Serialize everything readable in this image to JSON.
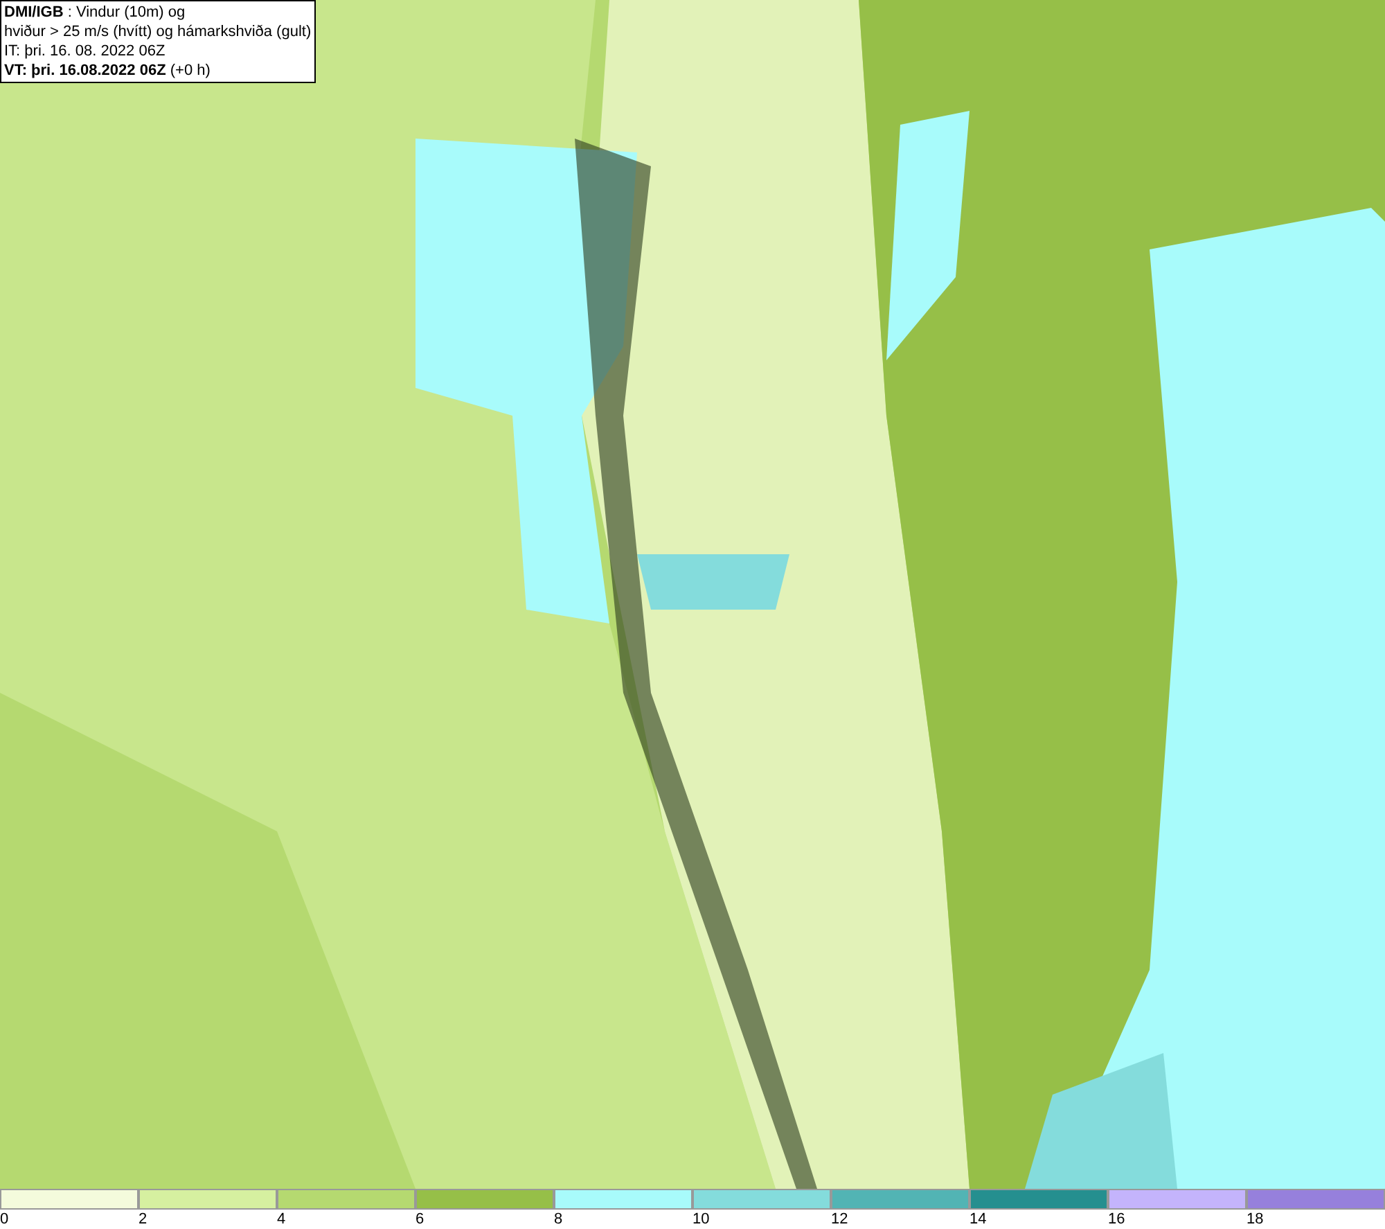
{
  "header": {
    "lines": [
      "**DMI/IGB** : Vindur (10m) og",
      "hviður > 25 m/s (hvítt) og hámarkshviða (gult)",
      "IT: þri. 16. 08. 2022 06Z",
      "**VT: þri. 16.08.2022 06Z** (+0 h)"
    ]
  },
  "legend": [
    {
      "label": "0",
      "color": "#f4fbdc"
    },
    {
      "label": "2",
      "color": "#d6f0a0"
    },
    {
      "label": "4",
      "color": "#b5d970"
    },
    {
      "label": "6",
      "color": "#96bf48"
    },
    {
      "label": "8",
      "color": "#a8fbfb"
    },
    {
      "label": "10",
      "color": "#84dcdc"
    },
    {
      "label": "12",
      "color": "#52b4b4"
    },
    {
      "label": "14",
      "color": "#258f8f"
    },
    {
      "label": "16",
      "color": "#c4b4fc"
    },
    {
      "label": "18",
      "color": "#9680dc"
    }
  ]
}
